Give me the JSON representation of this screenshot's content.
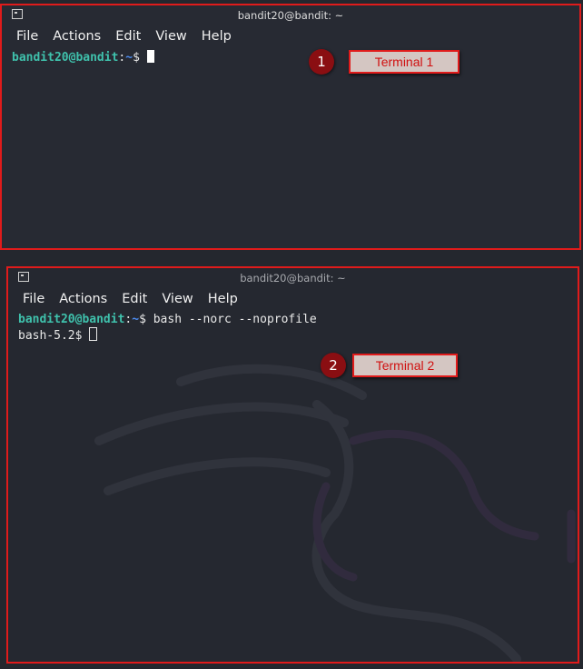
{
  "terminal1": {
    "title": "bandit20@bandit: ~",
    "menu": [
      "File",
      "Actions",
      "Edit",
      "View",
      "Help"
    ],
    "prompt_user": "bandit20@bandit",
    "prompt_sep": ":",
    "prompt_path": "~",
    "prompt_symbol": "$ ",
    "annotation_number": "1",
    "annotation_label": "Terminal 1"
  },
  "terminal2": {
    "title": "bandit20@bandit: ~",
    "menu": [
      "File",
      "Actions",
      "Edit",
      "View",
      "Help"
    ],
    "prompt_user": "bandit20@bandit",
    "prompt_sep": ":",
    "prompt_path": "~",
    "prompt_symbol": "$ ",
    "command": "bash --norc --noprofile",
    "second_prompt": "bash-5.2$ ",
    "annotation_number": "2",
    "annotation_label": "Terminal 2"
  },
  "colors": {
    "annotation_border": "#e01b1b",
    "prompt_user": "#3fc1ac",
    "prompt_path": "#4d8cf0"
  }
}
